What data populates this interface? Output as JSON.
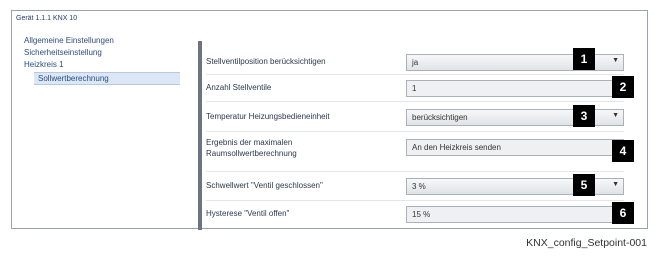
{
  "device_title": "Gerät 1.1.1  KNX 10",
  "sidebar": {
    "items": [
      {
        "label": "Allgemeine Einstellungen"
      },
      {
        "label": "Sicherheitseinstellung"
      },
      {
        "label": "Heizkreis 1"
      },
      {
        "label": "Sollwertberechnung",
        "selected": true
      }
    ]
  },
  "params": [
    {
      "label": "Stellventilposition berücksichtigen",
      "value": "ja",
      "control": "dropdown",
      "badge": "1"
    },
    {
      "label": "Anzahl Stellventile",
      "value": "1",
      "control": "text",
      "badge": "2"
    },
    {
      "label": "Temperatur Heizungsbedieneinheit",
      "value": "berücksichtigen",
      "control": "dropdown",
      "badge": "3"
    },
    {
      "label_line1": "Ergebnis der maximalen",
      "label_line2": "Raumsollwertberechnung",
      "value": "An den Heizkreis senden",
      "control": "text",
      "badge": "4"
    },
    {
      "label": "Schwellwert \"Ventil geschlossen\"",
      "value": "3 %",
      "control": "dropdown",
      "badge": "5"
    },
    {
      "label": "Hysterese \"Ventil offen\"",
      "value": "15 %",
      "control": "text",
      "badge": "6"
    }
  ],
  "icons": {
    "dropdown": "chevron-down-icon"
  },
  "colors": {
    "badge_bg": "#000000",
    "badge_fg": "#ffffff",
    "divider": "#6b7480",
    "sidebar_text": "#2a4d80"
  },
  "caption": "KNX_config_Setpoint-001"
}
